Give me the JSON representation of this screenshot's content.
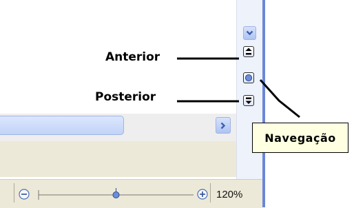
{
  "callouts": {
    "anterior": "Anterior",
    "posterior": "Posterior"
  },
  "tooltip": {
    "text": "Navegação"
  },
  "statusbar": {
    "zoom_level": "120%"
  },
  "zoom_slider": {
    "position_fraction": 0.5
  },
  "colors": {
    "scrollbar_accent": "#6c87d6",
    "tooltip_bg": "#ffffe1",
    "panel_gray": "#ece9d8"
  },
  "icons": {
    "scroll_down": "chevron-down-icon",
    "previous_page": "previous-page-icon",
    "navigation": "navigation-circle-icon",
    "next_page": "next-page-icon",
    "scroll_right": "chevron-right-icon",
    "zoom_out": "zoom-out-icon",
    "zoom_in": "zoom-in-icon"
  }
}
